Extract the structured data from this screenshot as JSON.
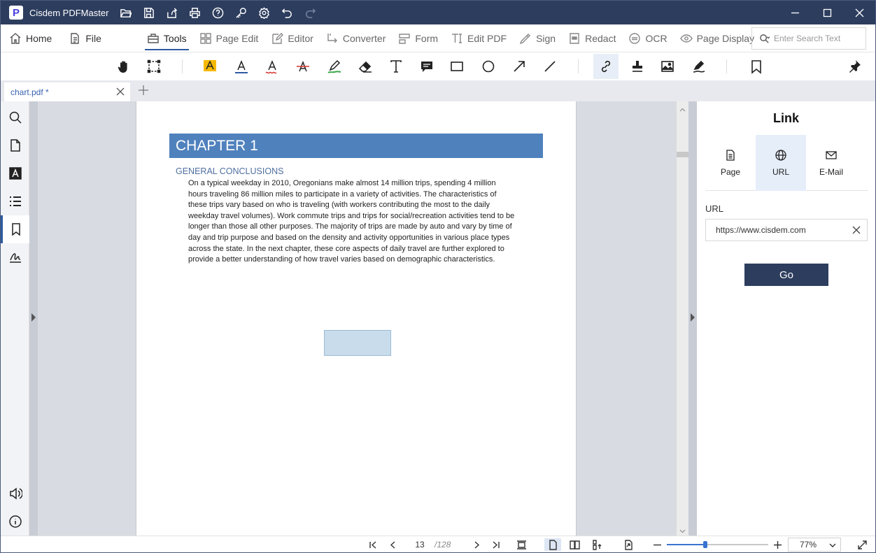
{
  "app": {
    "title": "Cisdem PDFMaster",
    "logo_letter": "P"
  },
  "menu": {
    "home": "Home",
    "file": "File",
    "tools": "Tools",
    "page_edit": "Page Edit",
    "editor": "Editor",
    "converter": "Converter",
    "form": "Form",
    "edit_pdf": "Edit PDF",
    "sign": "Sign",
    "redact": "Redact",
    "ocr": "OCR",
    "page_display": "Page Display"
  },
  "search": {
    "placeholder": "Enter Search Text"
  },
  "tab": {
    "name": "chart.pdf *"
  },
  "document": {
    "chapter": "CHAPTER 1",
    "subheading": "GENERAL CONCLUSIONS",
    "lines": [
      "On a typical weekday in 2010, Oregonians make almost 14 million trips, spending 4 million",
      "hours traveling 86 million miles to participate in a variety of activities. The characteristics of",
      "these trips vary based on who is traveling (with workers contributing the most to the daily",
      "weekday travel volumes). Work commute trips and trips for social/recreation activities tend to be",
      "longer than those all other purposes. The majority of trips are made by auto and vary by time of",
      "day and trip purpose and based on the density and activity opportunities in various place types",
      "across the state. In the next chapter, these core aspects of daily travel are further explored to",
      "provide a better understanding of how travel varies based on demographic characteristics."
    ]
  },
  "link_panel": {
    "title": "Link",
    "tabs": [
      "Page",
      "URL",
      "E-Mail"
    ],
    "selected_tab": "URL",
    "url_label": "URL",
    "url_value": "https://www.cisdem.com",
    "go_label": "Go"
  },
  "status": {
    "current_page": "13",
    "total_pages": "/128",
    "zoom_label": "77%",
    "zoom_slider_fraction": 0.38
  },
  "colors": {
    "titlebar": "#2d3d5e",
    "chapter_banner": "#4f81bd",
    "accent": "#2d5aa0",
    "link_box": "#c8dceb"
  }
}
